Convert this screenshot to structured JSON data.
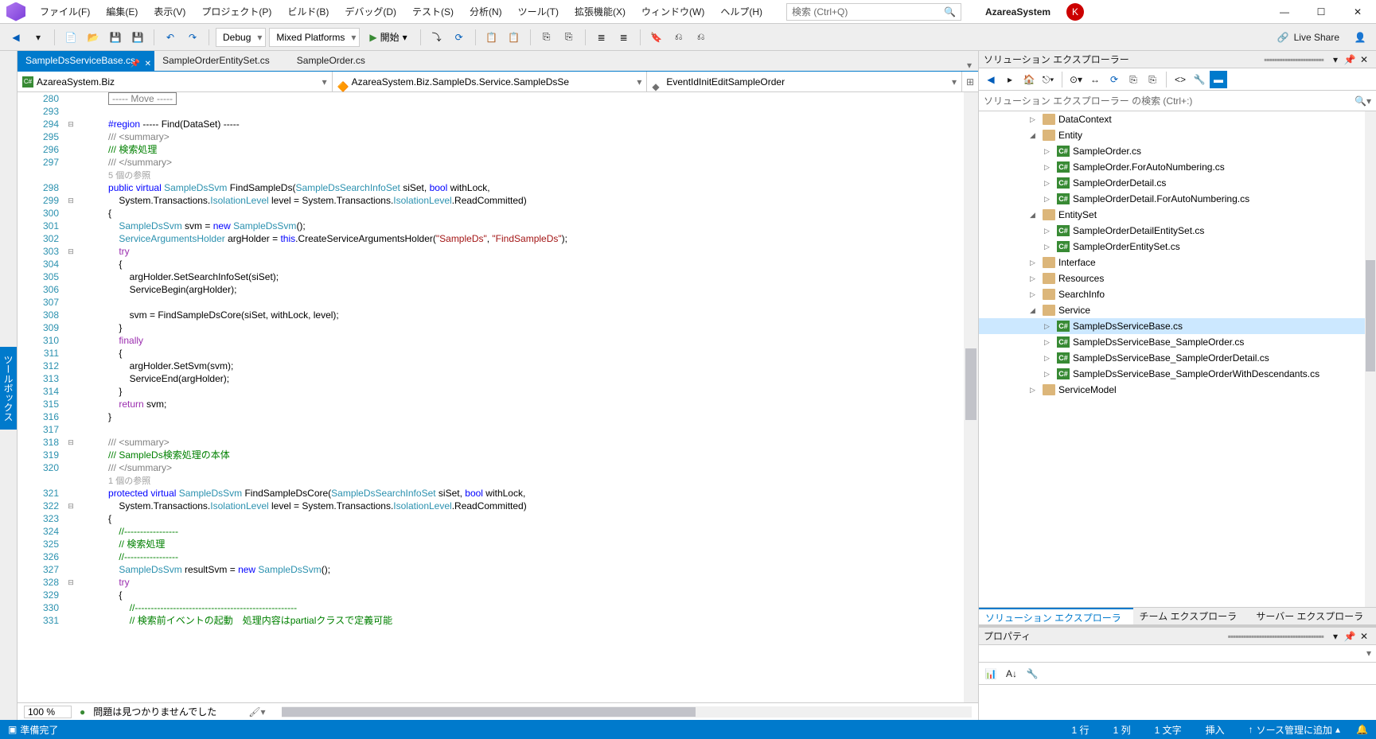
{
  "menu": [
    "ファイル(F)",
    "編集(E)",
    "表示(V)",
    "プロジェクト(P)",
    "ビルド(B)",
    "デバッグ(D)",
    "テスト(S)",
    "分析(N)",
    "ツール(T)",
    "拡張機能(X)",
    "ウィンドウ(W)",
    "ヘルプ(H)"
  ],
  "search_placeholder": "検索 (Ctrl+Q)",
  "project_name": "AzareaSystem",
  "user_initial": "K",
  "toolbar": {
    "config": "Debug",
    "platform": "Mixed Platforms",
    "start": "開始",
    "live_share": "Live Share"
  },
  "side_tab": "ツールボックス",
  "tabs": [
    {
      "label": "SampleDsServiceBase.cs",
      "active": true,
      "pinned": true
    },
    {
      "label": "SampleOrderEntitySet.cs",
      "active": false
    },
    {
      "label": "SampleOrder.cs",
      "active": false
    }
  ],
  "nav": {
    "ns": "AzareaSystem.Biz",
    "cls": "AzareaSystem.Biz.SampleDs.Service.SampleDsSe",
    "member": "EventIdInitEditSampleOrder"
  },
  "line_start": 280,
  "code_lines": [
    {
      "n": 280,
      "fold": "",
      "html": "            <span class='box'>----- Move -----</span>"
    },
    {
      "n": 293,
      "fold": "",
      "html": ""
    },
    {
      "n": 294,
      "fold": "-",
      "html": "            <span class='region'>#region</span> ----- Find(DataSet) -----"
    },
    {
      "n": 295,
      "fold": "",
      "html": "            <span class='xml'>/// &lt;summary&gt;</span>"
    },
    {
      "n": 296,
      "fold": "",
      "html": "            <span class='cmt'>/// 検索処理</span>"
    },
    {
      "n": 297,
      "fold": "",
      "html": "            <span class='xml'>/// &lt;/summary&gt;</span>"
    },
    {
      "n": 0,
      "fold": "",
      "html": "            <span class='ref'>5 個の参照</span>"
    },
    {
      "n": 298,
      "fold": "",
      "html": "            <span class='kw'>public</span> <span class='kw'>virtual</span> <span class='type'>SampleDsSvm</span> FindSampleDs(<span class='type'>SampleDsSearchInfoSet</span> siSet, <span class='kw'>bool</span> withLock,"
    },
    {
      "n": 299,
      "fold": "-",
      "html": "                System.Transactions.<span class='type'>IsolationLevel</span> level = System.Transactions.<span class='type'>IsolationLevel</span>.ReadCommitted)"
    },
    {
      "n": 300,
      "fold": "",
      "html": "            {"
    },
    {
      "n": 301,
      "fold": "",
      "html": "                <span class='type'>SampleDsSvm</span> svm = <span class='kw'>new</span> <span class='type'>SampleDsSvm</span>();"
    },
    {
      "n": 302,
      "fold": "",
      "html": "                <span class='type'>ServiceArgumentsHolder</span> argHolder = <span class='kw'>this</span>.CreateServiceArgumentsHolder(<span class='str'>\"SampleDs\"</span>, <span class='str'>\"FindSampleDs\"</span>);"
    },
    {
      "n": 303,
      "fold": "-",
      "html": "                <span class='mag'>try</span>"
    },
    {
      "n": 304,
      "fold": "",
      "html": "                {"
    },
    {
      "n": 305,
      "fold": "",
      "html": "                    argHolder.SetSearchInfoSet(siSet);"
    },
    {
      "n": 306,
      "fold": "",
      "html": "                    ServiceBegin(argHolder);"
    },
    {
      "n": 307,
      "fold": "",
      "html": ""
    },
    {
      "n": 308,
      "fold": "",
      "html": "                    svm = FindSampleDsCore(siSet, withLock, level);"
    },
    {
      "n": 309,
      "fold": "",
      "html": "                }"
    },
    {
      "n": 310,
      "fold": "",
      "html": "                <span class='mag'>finally</span>"
    },
    {
      "n": 311,
      "fold": "",
      "html": "                {"
    },
    {
      "n": 312,
      "fold": "",
      "html": "                    argHolder.SetSvm(svm);"
    },
    {
      "n": 313,
      "fold": "",
      "html": "                    ServiceEnd(argHolder);"
    },
    {
      "n": 314,
      "fold": "",
      "html": "                }"
    },
    {
      "n": 315,
      "fold": "",
      "html": "                <span class='mag'>return</span> svm;"
    },
    {
      "n": 316,
      "fold": "",
      "html": "            }"
    },
    {
      "n": 317,
      "fold": "",
      "html": ""
    },
    {
      "n": 318,
      "fold": "-",
      "html": "            <span class='xml'>/// &lt;summary&gt;</span>"
    },
    {
      "n": 319,
      "fold": "",
      "html": "            <span class='cmt'>/// SampleDs検索処理の本体</span>"
    },
    {
      "n": 320,
      "fold": "",
      "html": "            <span class='xml'>/// &lt;/summary&gt;</span>"
    },
    {
      "n": 0,
      "fold": "",
      "html": "            <span class='ref'>1 個の参照</span>"
    },
    {
      "n": 321,
      "fold": "",
      "html": "            <span class='kw'>protected</span> <span class='kw'>virtual</span> <span class='type'>SampleDsSvm</span> FindSampleDsCore(<span class='type'>SampleDsSearchInfoSet</span> siSet, <span class='kw'>bool</span> withLock,"
    },
    {
      "n": 322,
      "fold": "-",
      "html": "                System.Transactions.<span class='type'>IsolationLevel</span> level = System.Transactions.<span class='type'>IsolationLevel</span>.ReadCommitted)"
    },
    {
      "n": 323,
      "fold": "",
      "html": "            {"
    },
    {
      "n": 324,
      "fold": "",
      "html": "                <span class='cmt'>//-----------------</span>"
    },
    {
      "n": 325,
      "fold": "",
      "html": "                <span class='cmt'>// 検索処理</span>"
    },
    {
      "n": 326,
      "fold": "",
      "html": "                <span class='cmt'>//-----------------</span>"
    },
    {
      "n": 327,
      "fold": "",
      "html": "                <span class='type'>SampleDsSvm</span> resultSvm = <span class='kw'>new</span> <span class='type'>SampleDsSvm</span>();"
    },
    {
      "n": 328,
      "fold": "-",
      "html": "                <span class='mag'>try</span>"
    },
    {
      "n": 329,
      "fold": "",
      "html": "                {"
    },
    {
      "n": 330,
      "fold": "",
      "html": "                    <span class='cmt'>//---------------------------------------------------</span>"
    },
    {
      "n": 331,
      "fold": "",
      "html": "                    <span class='cmt'>// 検索前イベントの起動　処理内容はpartialクラスで定義可能</span>"
    }
  ],
  "editor_footer": {
    "zoom": "100 %",
    "issues": "問題は見つかりませんでした"
  },
  "solution_explorer": {
    "title": "ソリューション エクスプローラー",
    "search_placeholder": "ソリューション エクスプローラー の検索 (Ctrl+:)",
    "tabs": [
      "ソリューション エクスプローラー",
      "チーム エクスプローラー",
      "サーバー エクスプローラー"
    ],
    "tree": [
      {
        "depth": 3,
        "exp": "▷",
        "ico": "folder",
        "label": "DataContext"
      },
      {
        "depth": 3,
        "exp": "◢",
        "ico": "folder",
        "label": "Entity"
      },
      {
        "depth": 4,
        "exp": "▷",
        "ico": "cs",
        "label": "SampleOrder.cs"
      },
      {
        "depth": 4,
        "exp": "▷",
        "ico": "cs",
        "label": "SampleOrder.ForAutoNumbering.cs"
      },
      {
        "depth": 4,
        "exp": "▷",
        "ico": "cs",
        "label": "SampleOrderDetail.cs"
      },
      {
        "depth": 4,
        "exp": "▷",
        "ico": "cs",
        "label": "SampleOrderDetail.ForAutoNumbering.cs"
      },
      {
        "depth": 3,
        "exp": "◢",
        "ico": "folder",
        "label": "EntitySet"
      },
      {
        "depth": 4,
        "exp": "▷",
        "ico": "cs",
        "label": "SampleOrderDetailEntitySet.cs"
      },
      {
        "depth": 4,
        "exp": "▷",
        "ico": "cs",
        "label": "SampleOrderEntitySet.cs"
      },
      {
        "depth": 3,
        "exp": "▷",
        "ico": "folder",
        "label": "Interface"
      },
      {
        "depth": 3,
        "exp": "▷",
        "ico": "folder",
        "label": "Resources"
      },
      {
        "depth": 3,
        "exp": "▷",
        "ico": "folder",
        "label": "SearchInfo"
      },
      {
        "depth": 3,
        "exp": "◢",
        "ico": "folder",
        "label": "Service"
      },
      {
        "depth": 4,
        "exp": "▷",
        "ico": "cs",
        "label": "SampleDsServiceBase.cs",
        "sel": true
      },
      {
        "depth": 4,
        "exp": "▷",
        "ico": "cs",
        "label": "SampleDsServiceBase_SampleOrder.cs"
      },
      {
        "depth": 4,
        "exp": "▷",
        "ico": "cs",
        "label": "SampleDsServiceBase_SampleOrderDetail.cs"
      },
      {
        "depth": 4,
        "exp": "▷",
        "ico": "cs",
        "label": "SampleDsServiceBase_SampleOrderWithDescendants.cs"
      },
      {
        "depth": 3,
        "exp": "▷",
        "ico": "folder",
        "label": "ServiceModel"
      }
    ]
  },
  "properties_title": "プロパティ",
  "status": {
    "ready": "準備完了",
    "line": "1 行",
    "col": "1 列",
    "char": "1 文字",
    "ins": "挿入",
    "scm": "ソース管理に追加"
  }
}
